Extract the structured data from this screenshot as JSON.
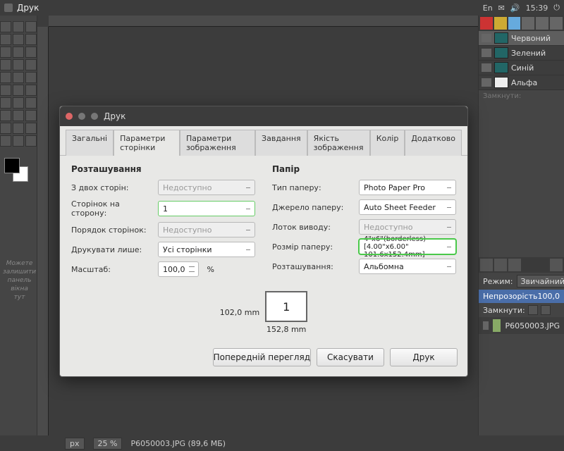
{
  "os": {
    "title": "Друк",
    "lang": "En",
    "time": "15:39"
  },
  "toolbox": {
    "dock_text": "Можете\nзалишити\nпанель\nвікна\nтут"
  },
  "layers": {
    "items": [
      {
        "name": "Червоний"
      },
      {
        "name": "Зелений"
      },
      {
        "name": "Синій"
      },
      {
        "name": "Альфа"
      }
    ],
    "lock_label": "Замкнути:",
    "mode_label": "Режим:",
    "mode_value": "Звичайний",
    "opacity_label": "Непрозорість",
    "opacity_value": "100,0",
    "image_name": "P6050003.JPG"
  },
  "status": {
    "unit": "px",
    "zoom": "25 %",
    "file": "P6050003.JPG (89,6 МБ)"
  },
  "dialog": {
    "title": "Друк",
    "tabs": [
      "Загальні",
      "Параметри сторінки",
      "Параметри зображення",
      "Завдання",
      "Якість зображення",
      "Колір",
      "Додатково"
    ],
    "active_tab": 1,
    "left": {
      "heading": "Розташування",
      "two_sided_label": "З двох сторін:",
      "two_sided_value": "Недоступно",
      "pages_per_side_label": "Сторінок на сторону:",
      "pages_per_side_value": "1",
      "page_order_label": "Порядок сторінок:",
      "page_order_value": "Недоступно",
      "print_only_label": "Друкувати лише:",
      "print_only_value": "Усі сторінки",
      "scale_label": "Масштаб:",
      "scale_value": "100,0",
      "scale_suffix": "%"
    },
    "right": {
      "heading": "Папір",
      "paper_type_label": "Тип паперу:",
      "paper_type_value": "Photo Paper Pro",
      "paper_source_label": "Джерело паперу:",
      "paper_source_value": "Auto Sheet Feeder",
      "output_tray_label": "Лоток виводу:",
      "output_tray_value": "Недоступно",
      "paper_size_label": "Розмір паперу:",
      "paper_size_value": "4\"x6\"(borderless) [4.00\"x6.00\" 101.6x152.4mm]",
      "orientation_label": "Розташування:",
      "orientation_value": "Альбомна"
    },
    "preview": {
      "height": "102,0 mm",
      "width": "152,8 mm",
      "page": "1"
    },
    "buttons": {
      "preview": "Попередній перегляд",
      "cancel": "Скасувати",
      "print": "Друк"
    }
  }
}
